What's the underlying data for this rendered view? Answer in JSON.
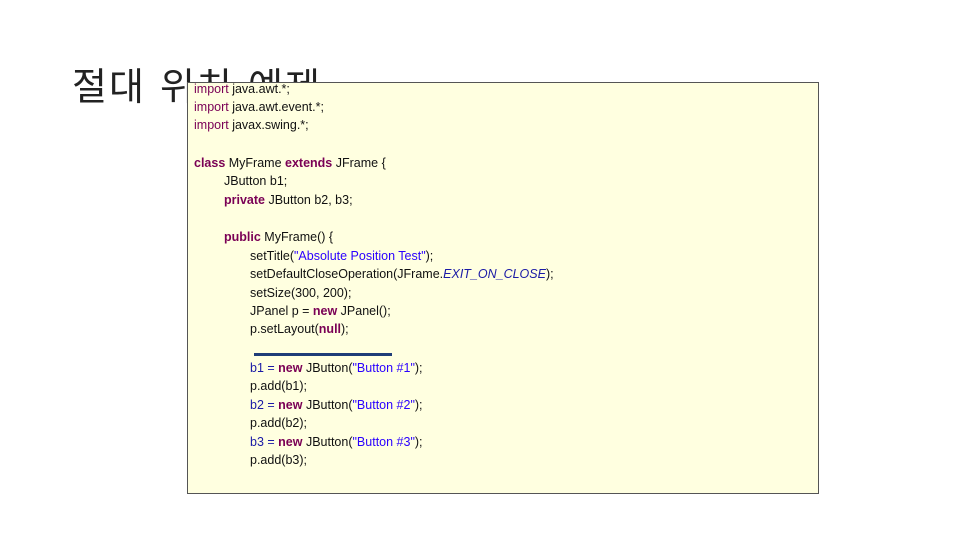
{
  "title": "절대 위치 예제",
  "code": {
    "l1_kw": "import",
    "l1_rest": " java.awt.*;",
    "l2_kw": "import",
    "l2_rest": " java.awt.event.*;",
    "l3_kw": "import",
    "l3_rest": " javax.swing.*;",
    "l4_kw": "class",
    "l4_a": " MyFrame ",
    "l4_kw2": "extends",
    "l4_b": " JFrame {",
    "l5": "JButton b1;",
    "l6_kw": "private",
    "l6_rest": " JButton b2, b3;",
    "l7_kw": "public",
    "l7_rest": " MyFrame() {",
    "l8_a": "setTitle(",
    "l8_str": "\"Absolute Position Test\"",
    "l8_b": ");",
    "l9_a": "setDefaultCloseOperation(JFrame.",
    "l9_it": "EXIT_ON_CLOSE",
    "l9_b": ");",
    "l10": "setSize(300, 200);",
    "l11_a": "JPanel p = ",
    "l11_kw": "new",
    "l11_b": " JPanel();",
    "l12_a": "p.setLayout(",
    "l12_kw": "null",
    "l12_b": ");",
    "l13_a": "b1 = ",
    "l13_kw": "new",
    "l13_b": " JButton(",
    "l13_str": "\"Button #1\"",
    "l13_c": ");",
    "l14": "p.add(b1);",
    "l15_a": "b2 = ",
    "l15_kw": "new",
    "l15_b": " JButton(",
    "l15_str": "\"Button #2\"",
    "l15_c": ");",
    "l16": "p.add(b2);",
    "l17_a": "b3 = ",
    "l17_kw": "new",
    "l17_b": " JButton(",
    "l17_str": "\"Button #3\"",
    "l17_c": ");",
    "l18": "p.add(b3);"
  }
}
